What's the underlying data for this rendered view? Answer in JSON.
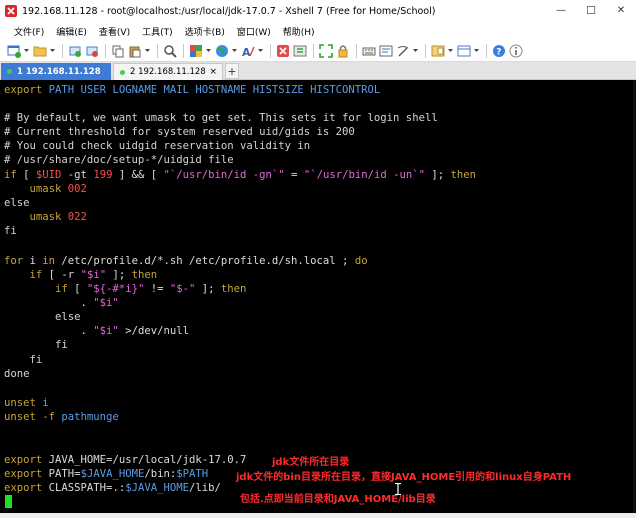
{
  "window": {
    "title": "192.168.11.128 - root@localhost:/usr/local/jdk-17.0.7 - Xshell 7 (Free for Home/School)",
    "minimize_glyph": "—",
    "maximize_glyph": "☐",
    "close_glyph": "✕"
  },
  "menu": [
    "文件(F)",
    "编辑(E)",
    "查看(V)",
    "工具(T)",
    "选项卡(B)",
    "窗口(W)",
    "帮助(H)"
  ],
  "tabs": [
    {
      "label": "1 192.168.11.128",
      "active": true
    },
    {
      "label": "2 192.168.11.128",
      "active": false
    }
  ],
  "tab_close_glyph": "×",
  "tab_add_glyph": "+",
  "terminal": {
    "l1": [
      "export",
      " PATH USER LOGNAME MAIL HOSTNAME HISTSIZE HISTCONTROL"
    ],
    "l3": "# By default, we want umask to get set. This sets it for login shell",
    "l4": "# Current threshold for system reserved uid/gids is 200",
    "l5": "# You could check uidgid reservation validity in",
    "l6": "# /usr/share/doc/setup-*/uidgid file",
    "l7": [
      "if",
      " [ ",
      "$UID",
      " -gt ",
      "199",
      " ] && [ ",
      "\"`/usr/bin/id -gn`\"",
      " = ",
      "\"`/usr/bin/id -un`\"",
      " ]; ",
      "then"
    ],
    "l8": [
      "    umask ",
      "002"
    ],
    "l9": "else",
    "l10": [
      "    umask ",
      "022"
    ],
    "l11": "fi",
    "l13": [
      "for",
      " i ",
      "in",
      " /etc/profile.d/*.sh /etc/profile.d/sh.local ; ",
      "do"
    ],
    "l14": [
      "    if",
      " [ -r ",
      "\"$i\"",
      " ]; ",
      "then"
    ],
    "l15": [
      "        if",
      " [ ",
      "\"${-#*i}\"",
      " != ",
      "\"$-\"",
      " ]; ",
      "then"
    ],
    "l16": [
      "            . ",
      "\"$i\""
    ],
    "l17": "        else",
    "l18": [
      "            . ",
      "\"$i\"",
      " >/dev/null"
    ],
    "l19": "        fi",
    "l20": "    fi",
    "l21": "done",
    "l23": [
      "unset",
      " i"
    ],
    "l24": [
      "unset",
      " -f ",
      "pathmunge"
    ],
    "l27": [
      "export",
      " JAVA_HOME=/usr/local/jdk-17.0.7"
    ],
    "l28": [
      "export",
      " PATH=",
      "$JAVA_HOME",
      "/bin:",
      "$PATH"
    ],
    "l29": [
      "export",
      " CLASSPATH=.:",
      "$JAVA_HOME",
      "/lib/"
    ]
  },
  "annotations": {
    "a1": "jdk文件所在目录",
    "a2": "jdk文件的bin目录所在目录，直接JAVA_HOME引用的和linux自身PATH",
    "a3": "包括.点即当前目录和JAVA_HOME/lib目录"
  },
  "colors": {
    "terminal_bg": "#000000",
    "keyword": "#c8a33a",
    "variable": "#5b9ce5",
    "number": "#ff4b4b",
    "string": "#e06ad6",
    "annotation": "#ff2b2b",
    "cursor": "#1fe01f",
    "active_tab": "#3e7bd5"
  },
  "icons": [
    "xshell-app-icon",
    "new-session-icon",
    "open-folder-icon",
    "reconnect-icon",
    "disconnect-icon",
    "copy-icon",
    "paste-icon",
    "find-icon",
    "color-scheme-icon",
    "globe-icon",
    "font-icon",
    "xftp-icon",
    "zmodem-icon",
    "fullscreen-icon",
    "lock-icon",
    "keyboard-icon",
    "compose-icon",
    "script-icon",
    "layout-icon",
    "help-icon",
    "info-icon"
  ]
}
